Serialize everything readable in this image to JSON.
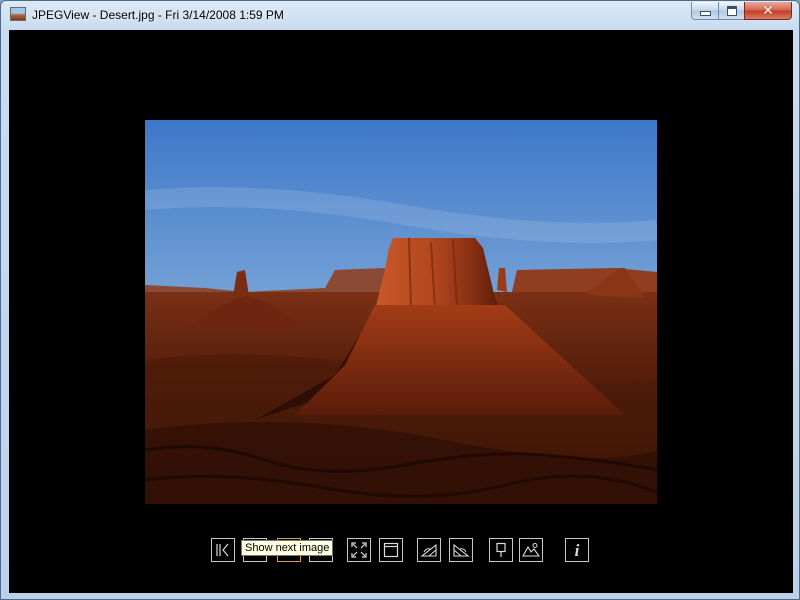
{
  "window": {
    "title": "JPEGView - Desert.jpg - Fri 3/14/2008 1:59 PM",
    "minimize_icon": "minimize-icon",
    "maximize_icon": "maximize-icon",
    "close_icon": "close-icon",
    "close_glyph": "✕"
  },
  "image": {
    "subject": "desert-photo",
    "colors": {
      "sky_top": "#3e78c9",
      "sky_bottom": "#c9dcec",
      "rock_lit": "#b3471e",
      "rock_dark": "#4a160a",
      "ground": "#3a1408"
    }
  },
  "toolbar": {
    "buttons": [
      {
        "icon": "first-image-icon"
      },
      {
        "icon": "previous-image-icon"
      },
      {
        "icon": "next-image-icon",
        "active": true
      },
      {
        "icon": "last-image-icon"
      },
      {
        "icon": "fit-to-screen-icon"
      },
      {
        "icon": "window-mode-icon"
      },
      {
        "icon": "rotate-clockwise-icon"
      },
      {
        "icon": "rotate-counterclockwise-icon"
      },
      {
        "icon": "keep-parameters-icon"
      },
      {
        "icon": "landscape-mode-icon"
      },
      {
        "icon": "info-icon"
      }
    ],
    "info_glyph": "i",
    "accent": "#d2a040"
  },
  "tooltip": {
    "text": "Show next image"
  }
}
